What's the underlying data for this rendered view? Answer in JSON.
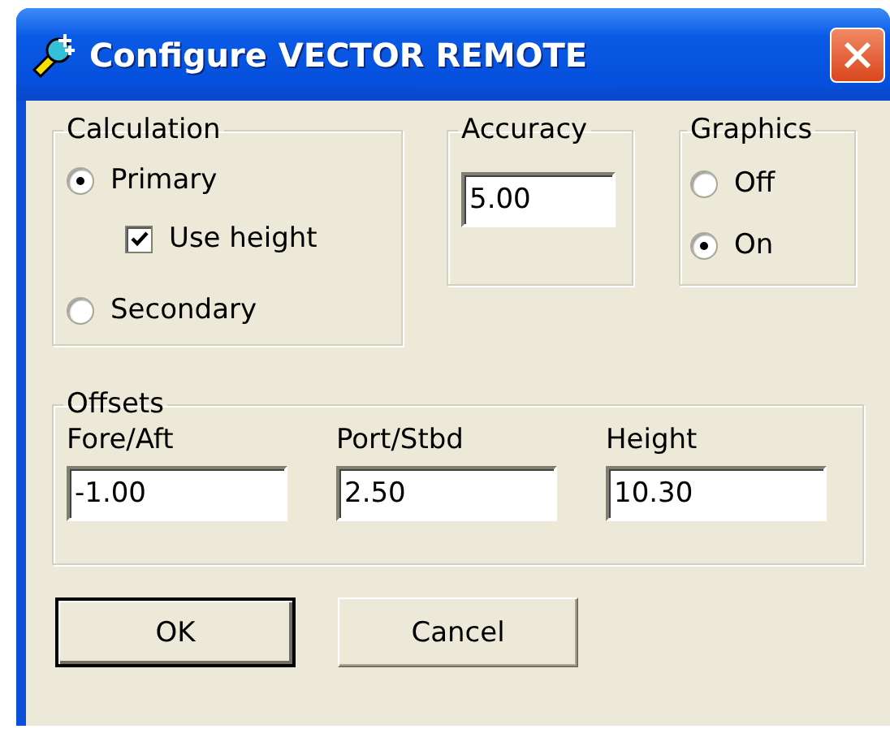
{
  "window": {
    "title": "Configure VECTOR REMOTE"
  },
  "calculation": {
    "label": "Calculation",
    "options": [
      {
        "label": "Primary",
        "selected": true
      },
      {
        "label": "Secondary",
        "selected": false
      }
    ],
    "use_height": {
      "label": "Use height",
      "checked": true
    }
  },
  "accuracy": {
    "label": "Accuracy",
    "value": "5.00"
  },
  "graphics": {
    "label": "Graphics",
    "options": [
      {
        "label": "Off",
        "selected": false
      },
      {
        "label": "On",
        "selected": true
      }
    ]
  },
  "offsets": {
    "label": "Offsets",
    "fields": [
      {
        "label": "Fore/Aft",
        "value": "-1.00"
      },
      {
        "label": "Port/Stbd",
        "value": "2.50"
      },
      {
        "label": "Height",
        "value": "10.30"
      }
    ]
  },
  "buttons": [
    {
      "label": "OK",
      "default": true
    },
    {
      "label": "Cancel",
      "default": false
    }
  ]
}
